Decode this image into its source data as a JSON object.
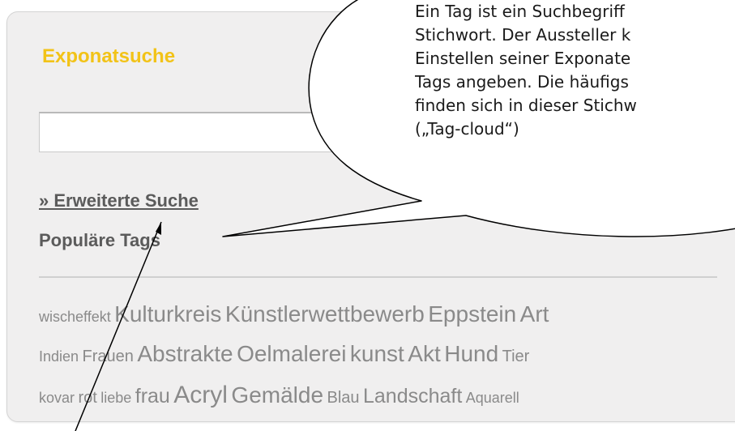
{
  "search": {
    "title": "Exponatsuche",
    "input_value": "",
    "advanced_link": "» Erweiterte Suche",
    "tags_heading": "Populäre Tags"
  },
  "tag_lines": [
    [
      {
        "label": "wischeffekt",
        "size": 1
      },
      {
        "label": "Kulturkreis",
        "size": 4
      },
      {
        "label": "Künstlerwettbewerb",
        "size": 4
      },
      {
        "label": "Eppstein",
        "size": 4
      },
      {
        "label": "Art",
        "size": 4
      }
    ],
    [
      {
        "label": "Indien",
        "size": 1
      },
      {
        "label": "Frauen",
        "size": 2
      },
      {
        "label": "Abstrakte",
        "size": 4
      },
      {
        "label": "Oelmalerei",
        "size": 4
      },
      {
        "label": "kunst",
        "size": 4
      },
      {
        "label": "Akt",
        "size": 4
      },
      {
        "label": "Hund",
        "size": 4
      },
      {
        "label": "Tier",
        "size": 2
      }
    ],
    [
      {
        "label": "kovar",
        "size": 1
      },
      {
        "label": "rot",
        "size": 2
      },
      {
        "label": "liebe",
        "size": 1
      },
      {
        "label": "frau",
        "size": 3
      },
      {
        "label": "Acryl",
        "size": 5
      },
      {
        "label": "Gemälde",
        "size": 4
      },
      {
        "label": "Blau",
        "size": 2
      },
      {
        "label": "Landschaft",
        "size": 3
      },
      {
        "label": "Aquarell",
        "size": 1
      }
    ]
  ],
  "callout": {
    "lines": [
      "Ein Tag ist ein Suchbegriff",
      "Stichwort. Der Aussteller k",
      "Einstellen seiner Exponate",
      "Tags angeben.  Die häufigs",
      "finden sich in dieser Stichw",
      "(„Tag-cloud“)"
    ]
  },
  "colors": {
    "title": "#f2c318",
    "link": "#5b5b5b",
    "tag": "#8a8a8a",
    "panel": "#f0efef"
  }
}
